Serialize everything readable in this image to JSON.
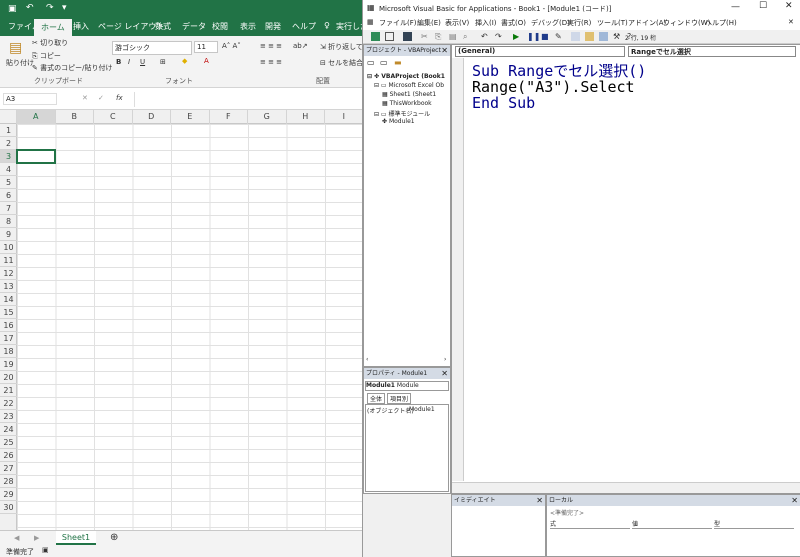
{
  "excel": {
    "tabs": [
      "ファイル",
      "ホーム",
      "挿入",
      "ページ レイアウト",
      "数式",
      "データ",
      "校閲",
      "表示",
      "開発",
      "ヘルプ"
    ],
    "search": "実行したい",
    "clipboard": {
      "paste": "貼り付け",
      "cut": "切り取り",
      "copy": "コピー",
      "format_copy": "書式のコピー/貼り付け",
      "group": "クリップボード"
    },
    "font": {
      "name": "游ゴシック",
      "size": "11",
      "group": "フォント",
      "bold": "B",
      "italic": "I",
      "underline": "U"
    },
    "align": {
      "wrap": "折り返して",
      "merge": "セルを結合",
      "group": "配置"
    },
    "namebox": "A3",
    "fx": "fx",
    "columns": [
      "A",
      "B",
      "C",
      "D",
      "E",
      "F",
      "G",
      "H",
      "I"
    ],
    "rows": [
      "1",
      "2",
      "3",
      "4",
      "5",
      "6",
      "7",
      "8",
      "9",
      "10",
      "11",
      "12",
      "13",
      "14",
      "15",
      "16",
      "17",
      "18",
      "19",
      "20",
      "21",
      "22",
      "23",
      "24",
      "25",
      "26",
      "27",
      "28",
      "29",
      "30"
    ],
    "sheet": "Sheet1",
    "status": "準備完了"
  },
  "vbe": {
    "title": "Microsoft Visual Basic for Applications - Book1 - [Module1 (コード)]",
    "menus": [
      "ファイル(F)",
      "編集(E)",
      "表示(V)",
      "挿入(I)",
      "書式(O)",
      "デバッグ(D)",
      "実行(R)",
      "ツール(T)",
      "アドイン(A)",
      "ウィンドウ(W)",
      "ヘルプ(H)"
    ],
    "position": "2 行, 19 桁",
    "project": {
      "header": "プロジェクト - VBAProject",
      "root": "VBAProject (Book1",
      "objects": "Microsoft Excel Ob",
      "sheet": "Sheet1 (Sheet1",
      "workbook": "ThisWorkbook",
      "modules": "標準モジュール",
      "module": "Module1"
    },
    "properties": {
      "header": "プロパティ - Module1",
      "object": "Module1",
      "type": "Module",
      "tab_all": "全体",
      "tab_cat": "項目別",
      "name_key": "(オブジェクト名)",
      "name_val": "Module1"
    },
    "combo_general": "(General)",
    "combo_proc": "Rangeでセル選択",
    "code": [
      "Sub Rangeでセル選択()",
      "Range(\"A3\").Select",
      "End Sub"
    ],
    "immediate": "イミディエイト",
    "locals": {
      "header": "ローカル",
      "status": "<準備完了>",
      "cols": [
        "式",
        "値",
        "型"
      ]
    }
  }
}
